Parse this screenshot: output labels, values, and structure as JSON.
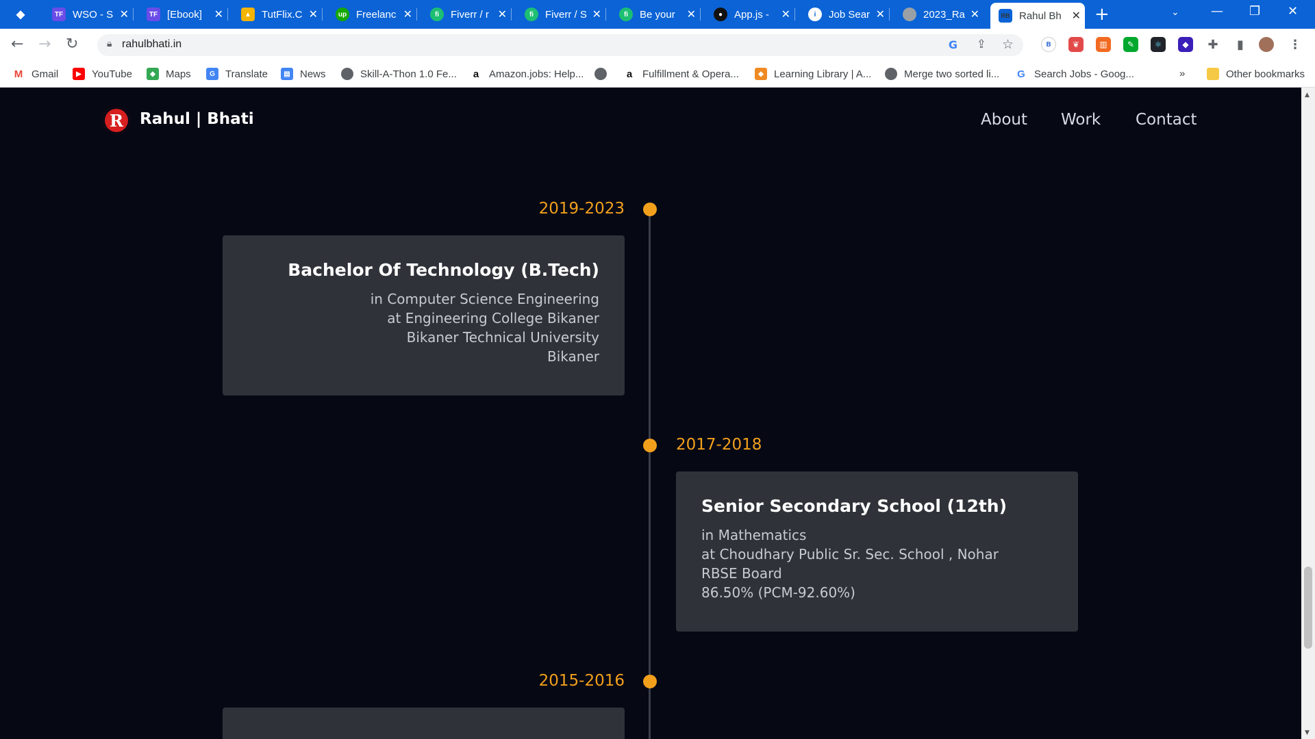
{
  "browser": {
    "tabs": [
      {
        "title": "",
        "icon": "diamond-icon",
        "color": "#ffffff"
      },
      {
        "title": "WSO - S",
        "icon": "tf-icon",
        "color": "#6a4ce8"
      },
      {
        "title": "[Ebook]",
        "icon": "tf-icon",
        "color": "#6a4ce8"
      },
      {
        "title": "TutFlix.C",
        "icon": "google-drive-icon",
        "color": "#f4b400"
      },
      {
        "title": "Freelanc",
        "icon": "upwork-icon",
        "color": "#14a800"
      },
      {
        "title": "Fiverr / r",
        "icon": "fiverr-icon",
        "color": "#1dbf73"
      },
      {
        "title": "Fiverr / S",
        "icon": "fiverr-icon",
        "color": "#1dbf73"
      },
      {
        "title": "Be your",
        "icon": "fiverr-icon",
        "color": "#1dbf73"
      },
      {
        "title": "App.js -",
        "icon": "github-icon",
        "color": "#111111"
      },
      {
        "title": "Job Sear",
        "icon": "info-icon",
        "color": "#ffffff"
      },
      {
        "title": "2023_Ra",
        "icon": "globe-icon",
        "color": "#9aa0a6"
      },
      {
        "title": "Rahul Bh",
        "icon": "rb-icon",
        "color": "#0b63d6"
      }
    ],
    "url": "rahulbhati.in",
    "bookmarks": [
      {
        "label": "Gmail",
        "icon": "gmail-icon",
        "color": "#ea4335"
      },
      {
        "label": "YouTube",
        "icon": "youtube-icon",
        "color": "#ff0000"
      },
      {
        "label": "Maps",
        "icon": "maps-icon",
        "color": "#34a853"
      },
      {
        "label": "Translate",
        "icon": "translate-icon",
        "color": "#4285f4"
      },
      {
        "label": "News",
        "icon": "news-icon",
        "color": "#4285f4"
      },
      {
        "label": "Skill-A-Thon 1.0 Fe...",
        "icon": "globe-icon",
        "color": "#5f6368"
      },
      {
        "label": "Amazon.jobs: Help...",
        "icon": "amazon-icon",
        "color": "#111111"
      },
      {
        "label": "",
        "icon": "globe-icon",
        "color": "#5f6368"
      },
      {
        "label": "Fulfillment & Opera...",
        "icon": "amazon-icon",
        "color": "#111111"
      },
      {
        "label": "Learning Library | A...",
        "icon": "cube-icon",
        "color": "#f08a24"
      },
      {
        "label": "Merge two sorted li...",
        "icon": "globe-icon",
        "color": "#5f6368"
      },
      {
        "label": "Search Jobs - Goog...",
        "icon": "google-icon",
        "color": "#4285f4"
      }
    ],
    "other_bookmarks": "Other bookmarks",
    "overflow": "»"
  },
  "site": {
    "logo_letter": "R",
    "logo_text": "Rahul | Bhati",
    "nav": [
      "About",
      "Work",
      "Contact"
    ]
  },
  "timeline": [
    {
      "years": "2019-2023",
      "title": "Bachelor Of Technology (B.Tech)",
      "lines": [
        "in Computer Science Engineering",
        "at Engineering College Bikaner",
        "Bikaner Technical University",
        "Bikaner"
      ]
    },
    {
      "years": "2017-2018",
      "title": "Senior Secondary School (12th)",
      "lines": [
        "in Mathematics",
        "at Choudhary Public Sr. Sec. School , Nohar",
        "RBSE Board",
        "86.50% (PCM-92.60%)"
      ]
    },
    {
      "years": "2015-2016",
      "title": "",
      "lines": []
    }
  ],
  "colors": {
    "page_bg": "#060814",
    "accent": "#f2a01c",
    "card_bg": "#2f3238",
    "browser_blue": "#0b63d6"
  }
}
